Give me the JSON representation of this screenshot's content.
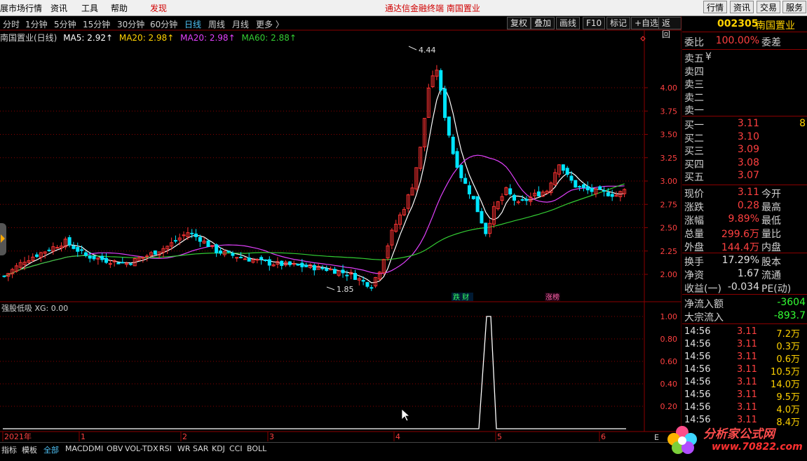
{
  "menubar": {
    "items": [
      "展市场行情",
      "资讯",
      "工具",
      "帮助",
      "发现"
    ],
    "center_title": "通达信金融终端   南国置业",
    "right_buttons": [
      "行情",
      "资讯",
      "交易",
      "服务"
    ]
  },
  "period_bar": {
    "periods": [
      "分时",
      "1分钟",
      "5分钟",
      "15分钟",
      "30分钟",
      "60分钟",
      "日线",
      "周线",
      "月线",
      "更多 〉"
    ],
    "selected": "日线",
    "tools": [
      "复权",
      "叠加",
      "画线",
      "F10",
      "标记",
      "+自选",
      "返回"
    ]
  },
  "main_header": {
    "title": "南国置业(日线)",
    "ma5": "MA5: 2.92↑",
    "ma20": "MA20: 2.98↑",
    "ma10": "MA20: 2.98↑",
    "ma60": "MA60: 2.88↑"
  },
  "indicator_header": "强股低吸 XG: 0.00",
  "colors": {
    "up": "#ff3333",
    "down": "#00e5ff",
    "ma5": "#ffffff",
    "ma20": "#e040fb",
    "ma60": "#33cc33",
    "grid": "#8b0000"
  },
  "chart_data": {
    "type": "candlestick",
    "y_range": [
      1.75,
      4.55
    ],
    "y_ticks": [
      "4.00",
      "3.75",
      "3.50",
      "3.25",
      "3.00",
      "2.75",
      "2.50",
      "2.25",
      "2.00"
    ],
    "x_ticks": [
      "2021年",
      "1",
      "2",
      "3",
      "4",
      "5",
      "6"
    ],
    "annotations": [
      "4.44",
      "1.85"
    ],
    "event_labels": [
      "跌 财",
      "涨榜"
    ],
    "indicator": {
      "y_ticks": [
        "1.00",
        "0.80",
        "0.60",
        "0.40",
        "0.20"
      ],
      "signal_value": 1.0
    }
  },
  "quote": {
    "code": "002305",
    "name": "南国置业",
    "weibi_label": "委比",
    "weibi_value": "100.00%",
    "weicha_label": "委差",
    "sells": [
      {
        "label": "卖五",
        "price": "¥"
      },
      {
        "label": "卖四",
        "price": ""
      },
      {
        "label": "卖三",
        "price": ""
      },
      {
        "label": "卖二",
        "price": ""
      },
      {
        "label": "卖一",
        "price": ""
      }
    ],
    "buys": [
      {
        "label": "买一",
        "price": "3.11",
        "vol": "8"
      },
      {
        "label": "买二",
        "price": "3.10",
        "vol": ""
      },
      {
        "label": "买三",
        "price": "3.09",
        "vol": ""
      },
      {
        "label": "买四",
        "price": "3.08",
        "vol": ""
      },
      {
        "label": "买五",
        "price": "3.07",
        "vol": ""
      }
    ],
    "stats": [
      {
        "label": "现价",
        "value": "3.11",
        "label2": "今开"
      },
      {
        "label": "涨跌",
        "value": "0.28",
        "label2": "最高"
      },
      {
        "label": "涨幅",
        "value": "9.89%",
        "label2": "最低"
      },
      {
        "label": "总量",
        "value": "299.6万",
        "label2": "量比"
      },
      {
        "label": "外盘",
        "value": "144.4万",
        "label2": "内盘"
      }
    ],
    "stats2": [
      {
        "label": "换手",
        "value": "17.29%",
        "label2": "股本"
      },
      {
        "label": "净资",
        "value": "1.67",
        "label2": "流通"
      },
      {
        "label": "收益(一)",
        "value": "-0.034",
        "label2": "PE(动)"
      }
    ],
    "flow": [
      {
        "label": "净流入额",
        "value": "-3604"
      },
      {
        "label": "大宗流入",
        "value": "-893.7"
      }
    ],
    "ticks": [
      {
        "time": "14:56",
        "price": "3.11",
        "vol": "7.2万"
      },
      {
        "time": "14:56",
        "price": "3.11",
        "vol": "0.3万"
      },
      {
        "time": "14:56",
        "price": "3.11",
        "vol": "0.6万"
      },
      {
        "time": "14:56",
        "price": "3.11",
        "vol": "10.5万"
      },
      {
        "time": "14:56",
        "price": "3.11",
        "vol": "14.0万"
      },
      {
        "time": "14:56",
        "price": "3.11",
        "vol": "9.5万"
      },
      {
        "time": "14:56",
        "price": "3.11",
        "vol": "4.0万"
      },
      {
        "time": "14:56",
        "price": "3.11",
        "vol": "8.4万"
      }
    ]
  },
  "bottom_bar": {
    "tabs": [
      "指标",
      "模板",
      "全部",
      "MACD",
      "DMI",
      "OBV",
      "VOL-TDX",
      "RSI",
      "WR",
      "SAR",
      "KDJ",
      "CCI",
      "BOLL"
    ],
    "selected": "全部"
  },
  "watermark": {
    "top": "分析家公式网",
    "bottom": "www.70822.com"
  }
}
